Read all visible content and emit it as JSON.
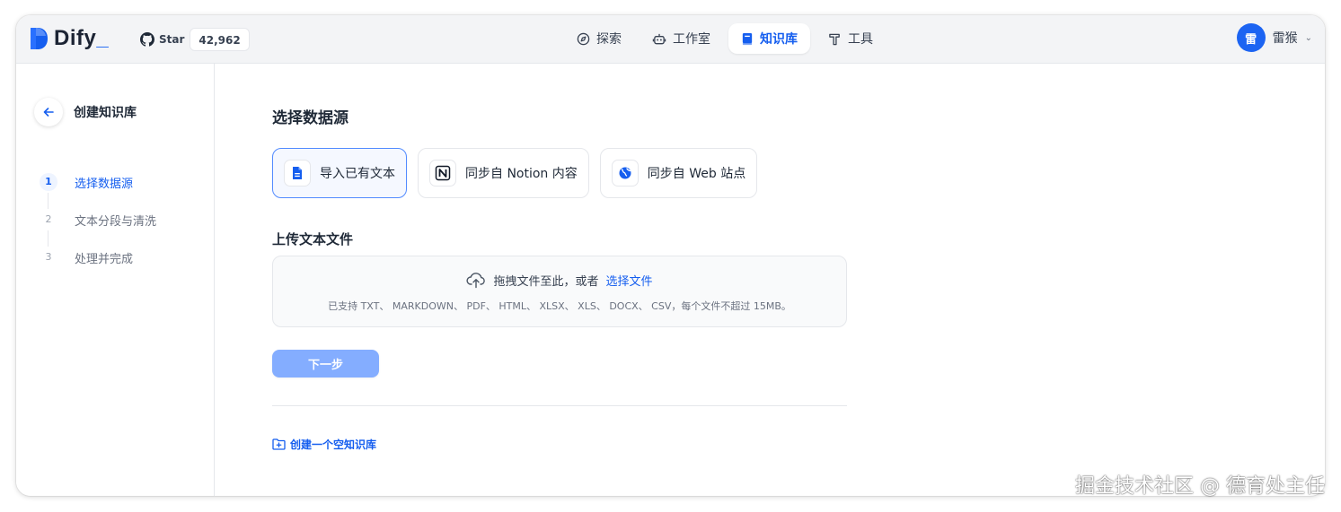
{
  "header": {
    "logo_text": "Dify",
    "logo_cursor": "_",
    "github_star_label": "Star",
    "github_star_count": "42,962",
    "nav": [
      {
        "label": "探索",
        "icon": "compass-icon"
      },
      {
        "label": "工作室",
        "icon": "robot-icon"
      },
      {
        "label": "知识库",
        "icon": "book-icon",
        "active": true
      },
      {
        "label": "工具",
        "icon": "hammer-icon"
      }
    ],
    "user": {
      "avatar_initial": "雷",
      "name": "雷猴"
    }
  },
  "sidebar": {
    "title": "创建知识库",
    "steps": [
      {
        "num": "1",
        "label": "选择数据源",
        "active": true
      },
      {
        "num": "2",
        "label": "文本分段与清洗"
      },
      {
        "num": "3",
        "label": "处理并完成"
      }
    ]
  },
  "main": {
    "section_title": "选择数据源",
    "sources": [
      {
        "label": "导入已有文本",
        "icon": "file-icon",
        "active": true
      },
      {
        "label": "同步自 Notion 内容",
        "icon": "notion-icon"
      },
      {
        "label": "同步自 Web 站点",
        "icon": "globe-icon"
      }
    ],
    "upload_title": "上传文本文件",
    "dropzone": {
      "prompt": "拖拽文件至此，或者",
      "link": "选择文件",
      "hint": "已支持 TXT、 MARKDOWN、 PDF、 HTML、 XLSX、 XLS、 DOCX、 CSV，每个文件不超过 15MB。"
    },
    "next_button": "下一步",
    "empty_link": "创建一个空知识库"
  },
  "watermark": "掘金技术社区 @ 德育处主任",
  "colors": {
    "accent": "#155eef",
    "button_disabled": "#84adff",
    "active_source_bg": "#f5f8ff"
  }
}
